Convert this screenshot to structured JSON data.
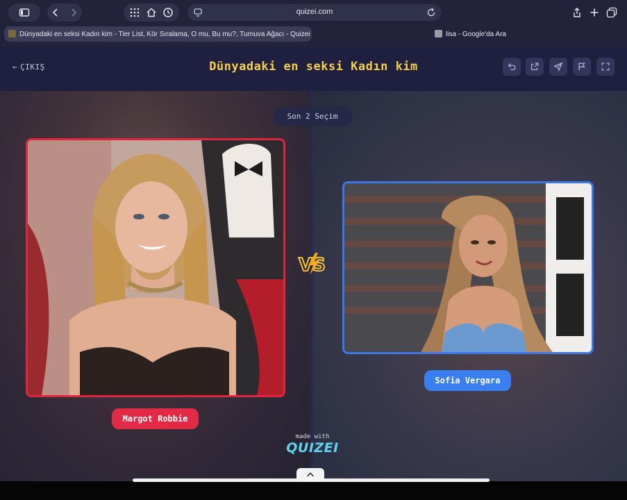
{
  "browser": {
    "url": "quizei.com",
    "tabs": [
      {
        "title": "Dünyadaki en seksi Kadın kim - Tier List, Kör Sıralama, O mu, Bu mu?, Turnuva Ağacı - Quizei",
        "active": true
      },
      {
        "title": "lisa - Google'da Ara",
        "active": false
      }
    ]
  },
  "header": {
    "back_label": "ÇIKIŞ",
    "title": "Dünyadaki en seksi Kadın kim",
    "actions": [
      "undo-icon",
      "share-icon",
      "send-icon",
      "flag-icon",
      "fullscreen-icon"
    ]
  },
  "round": {
    "badge": "Son 2 Seçim",
    "vs_label": "VS"
  },
  "choices": {
    "left": {
      "name": "Margot Robbie",
      "accent": "#e22a46"
    },
    "right": {
      "name": "Sofia Vergara",
      "accent": "#3a7ff0"
    }
  },
  "footer": {
    "made_with": "made with",
    "brand": "QUIZEI"
  },
  "colors": {
    "title": "#f5d04a",
    "header_bg": "#1f2040",
    "brand": "#5fd3f0"
  }
}
